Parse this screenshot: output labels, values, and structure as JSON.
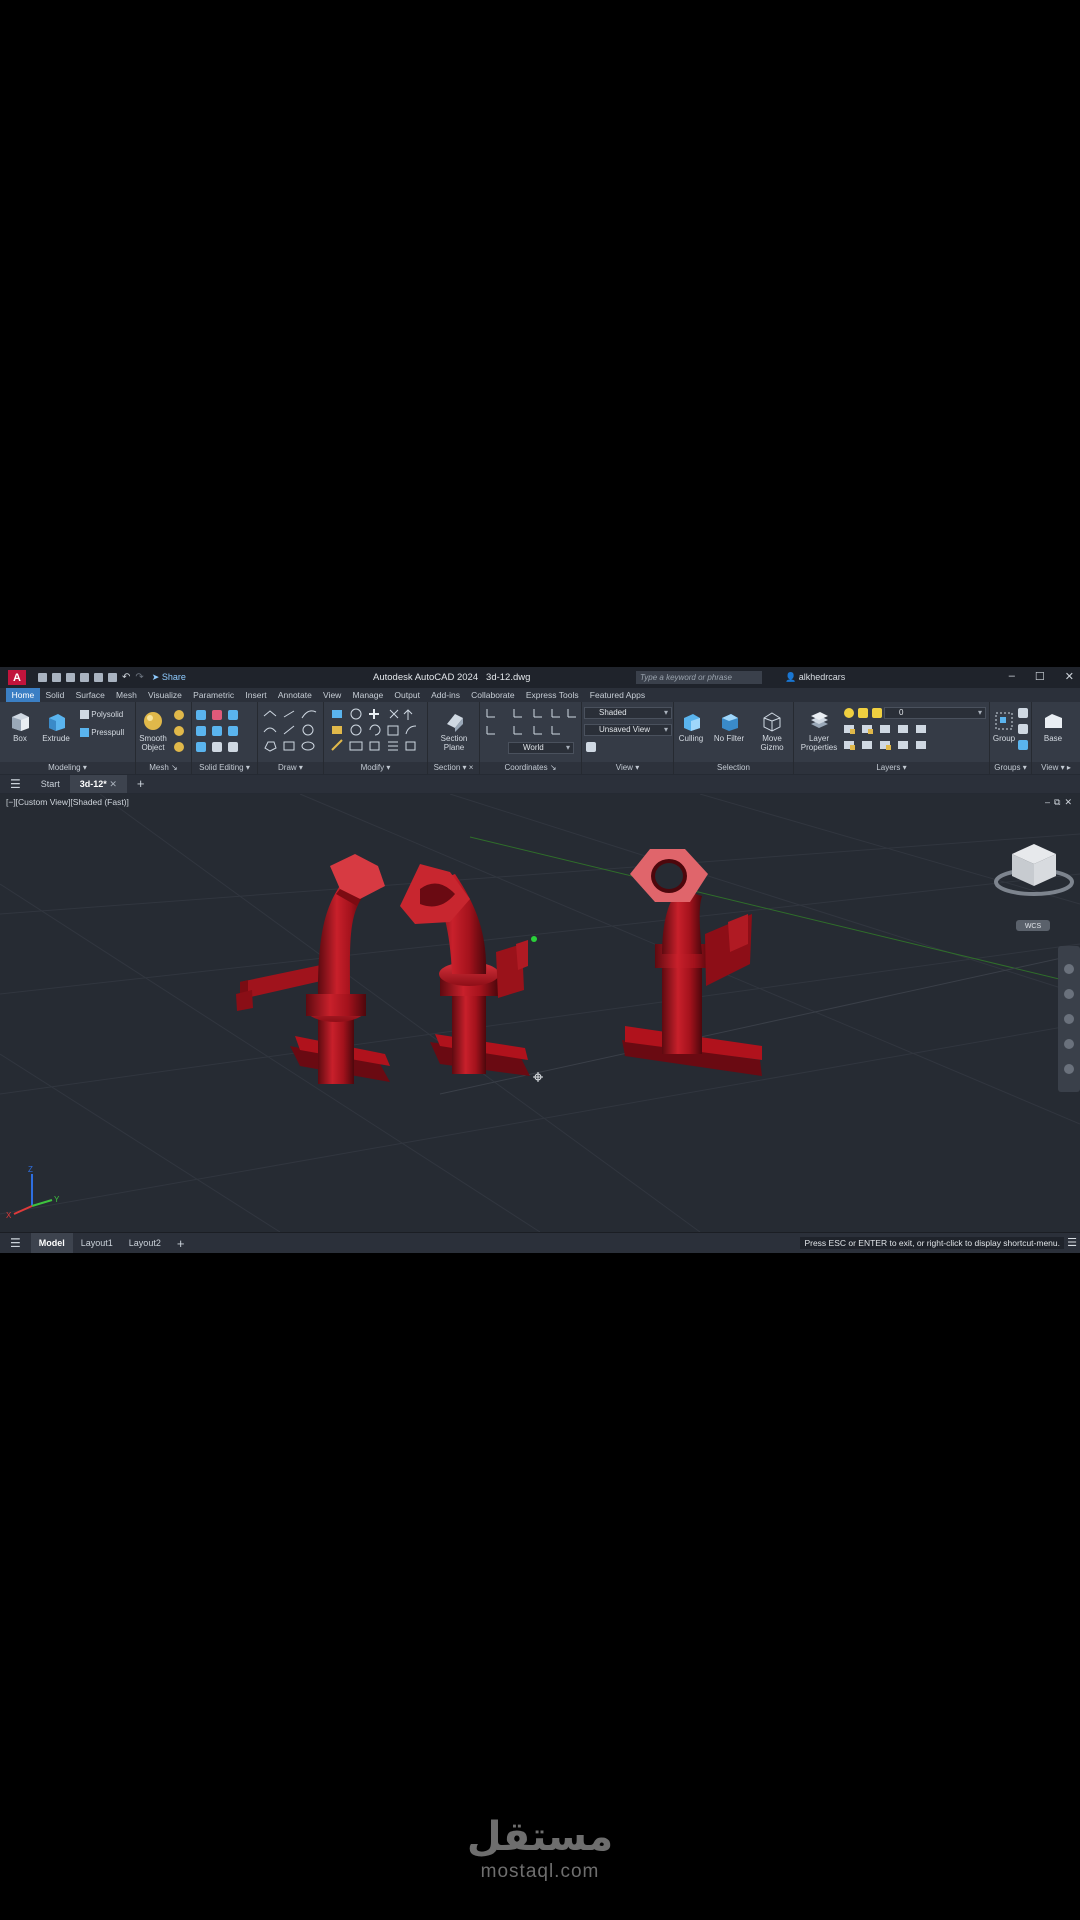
{
  "window": {
    "app_icon": "A",
    "title": "Autodesk AutoCAD 2024",
    "file": "3d-12.dwg",
    "share_label": "Share",
    "search_placeholder": "Type a keyword or phrase",
    "user": "alkhedrcars"
  },
  "ribbon_tabs": [
    "Home",
    "Solid",
    "Surface",
    "Mesh",
    "Visualize",
    "Parametric",
    "Insert",
    "Annotate",
    "View",
    "Manage",
    "Output",
    "Add-ins",
    "Collaborate",
    "Express Tools",
    "Featured Apps"
  ],
  "ribbon": {
    "modeling": {
      "title": "Modeling",
      "box": "Box",
      "extrude": "Extrude",
      "polysolid": "Polysolid",
      "presspull": "Presspull"
    },
    "mesh": {
      "title": "Mesh",
      "smooth_1": "Smooth",
      "smooth_2": "Object"
    },
    "solid_editing": {
      "title": "Solid Editing"
    },
    "draw": {
      "title": "Draw"
    },
    "modify": {
      "title": "Modify"
    },
    "section": {
      "title": "Section",
      "plane_1": "Section",
      "plane_2": "Plane"
    },
    "coordinates": {
      "title": "Coordinates",
      "world": "World"
    },
    "view": {
      "title": "View",
      "visual_style": "Shaded",
      "named_view": "Unsaved View"
    },
    "selection": {
      "title": "Selection",
      "culling": "Culling",
      "no_filter": "No Filter",
      "gizmo_1": "Move",
      "gizmo_2": "Gizmo"
    },
    "layers": {
      "title": "Layers",
      "layer_props_1": "Layer",
      "layer_props_2": "Properties",
      "current_layer": "0"
    },
    "groups": {
      "title": "Groups",
      "group": "Group"
    },
    "view2": {
      "title": "View",
      "base": "Base"
    }
  },
  "file_tabs": [
    "Start",
    "3d-12*"
  ],
  "viewport": {
    "label": "[−][Custom View][Shaded (Fast)]",
    "wcs": "WCS",
    "ucs_x": "X",
    "ucs_y": "Y",
    "ucs_z": "Z"
  },
  "layout_tabs": [
    "Model",
    "Layout1",
    "Layout2"
  ],
  "status_message": "Press ESC or ENTER to exit, or right-click to display shortcut-menu.",
  "watermark": {
    "arabic": "مستقل",
    "latin": "mostaql.com"
  },
  "colors": {
    "accent": "#3b7fc4",
    "model_red": "#b0121c",
    "brand": "#c1143c"
  }
}
